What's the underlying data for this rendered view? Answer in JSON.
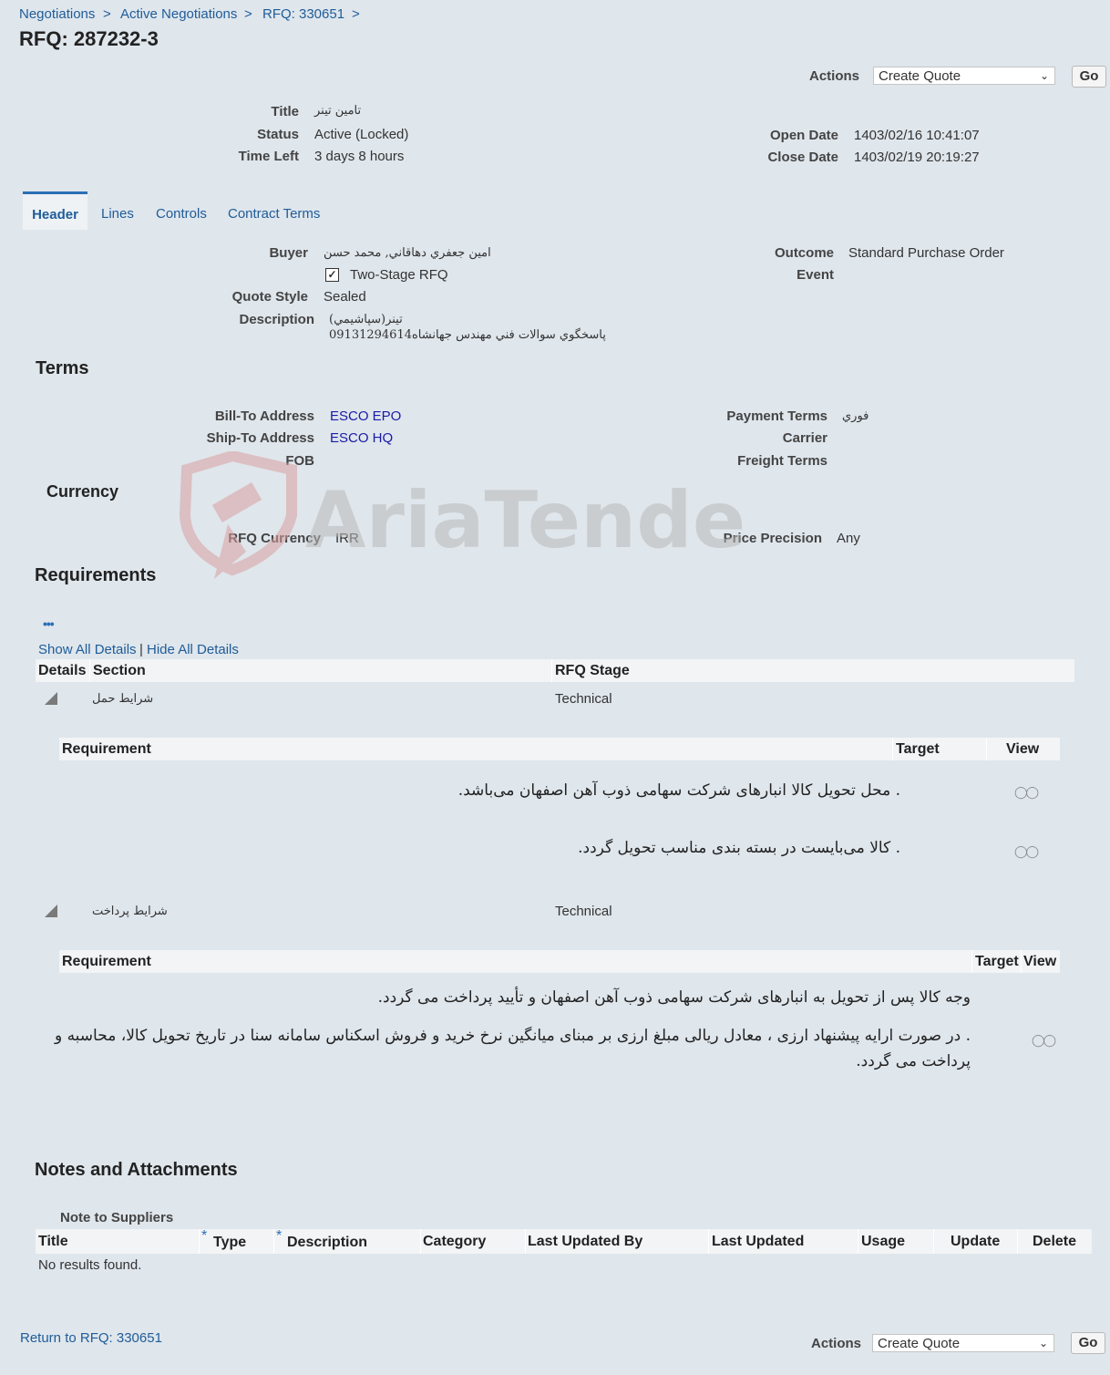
{
  "breadcrumb": [
    "Negotiations",
    "Active Negotiations",
    "RFQ: 330651"
  ],
  "breadcrumb_sep": ">",
  "page_title": "RFQ: 287232-3",
  "actions": {
    "label": "Actions",
    "selected": "Create Quote",
    "go": "Go"
  },
  "summary": {
    "title_label": "Title",
    "title_value": "تامين تينر",
    "status_label": "Status",
    "status_value": "Active (Locked)",
    "timeleft_label": "Time Left",
    "timeleft_value": "3 days 8 hours",
    "opendate_label": "Open Date",
    "opendate_value": "1403/02/16 10:41:07",
    "closedate_label": "Close Date",
    "closedate_value": "1403/02/19 20:19:27"
  },
  "tabs": [
    "Header",
    "Lines",
    "Controls",
    "Contract Terms"
  ],
  "header": {
    "buyer_label": "Buyer",
    "buyer_value": "امين جعفري دهاقاني, محمد حسن",
    "two_stage_label": "Two-Stage RFQ",
    "two_stage_checked": true,
    "quote_style_label": "Quote Style",
    "quote_style_value": "Sealed",
    "description_label": "Description",
    "description_line1": "تينر(سپاشيمي)",
    "description_line2": "پاسخگوي سوالات فني مهندس جهانشاه09131294614",
    "outcome_label": "Outcome",
    "outcome_value": "Standard Purchase Order",
    "event_label": "Event"
  },
  "terms": {
    "heading": "Terms",
    "billto_label": "Bill-To Address",
    "billto_value": "ESCO EPO",
    "shipto_label": "Ship-To Address",
    "shipto_value": "ESCO HQ",
    "fob_label": "FOB",
    "payment_label": "Payment Terms",
    "payment_value": "فوري",
    "carrier_label": "Carrier",
    "freight_label": "Freight Terms"
  },
  "currency": {
    "heading": "Currency",
    "rfq_currency_label": "RFQ Currency",
    "rfq_currency_value": "IRR",
    "precision_label": "Price Precision",
    "precision_value": "Any"
  },
  "requirements": {
    "heading": "Requirements",
    "more": "•••",
    "show_all": "Show All Details",
    "divider": "|",
    "hide_all": "Hide All Details",
    "col_details": "Details",
    "col_section": "Section",
    "col_stage": "RFQ Stage",
    "sections": [
      {
        "name": "شرایط حمل",
        "stage": "Technical",
        "col_req": "Requirement",
        "col_target": "Target",
        "col_view": "View",
        "items": [
          ". محل تحویل کالا انبارهای شرکت سهامی ذوب آهن اصفهان می‌باشد.",
          ". کالا می‌بایست در بسته بندی مناسب تحویل گردد."
        ]
      },
      {
        "name": "شرایط پرداخت",
        "stage": "Technical",
        "col_req": "Requirement",
        "col_target": "Target",
        "col_view": "View",
        "items": [
          "وجه کالا پس از تحویل به انبارهای شرکت سهامی ذوب آهن اصفهان و تأیید پرداخت می گردد.",
          ". در صورت ارایه پیشنهاد ارزی ، معادل ریالی مبلغ ارزی بر مبنای میانگین نرخ خرید و فروش اسکناس سامانه سنا در تاریخ تحویل کالا، محاسبه و",
          "پرداخت می گردد."
        ]
      }
    ]
  },
  "notes": {
    "heading": "Notes and Attachments",
    "note_to_suppliers": "Note to Suppliers",
    "required_mark": "*",
    "columns": [
      "Title",
      "Type",
      "Description",
      "Category",
      "Last Updated By",
      "Last Updated",
      "Usage",
      "Update",
      "Delete"
    ],
    "empty": "No results found."
  },
  "return_link": "Return to RFQ: 330651",
  "watermark": "AriaTender.neT",
  "colors": {
    "link": "#1f5c99",
    "background": "#dfe6ec",
    "tab_accent": "#2b6fb5"
  }
}
